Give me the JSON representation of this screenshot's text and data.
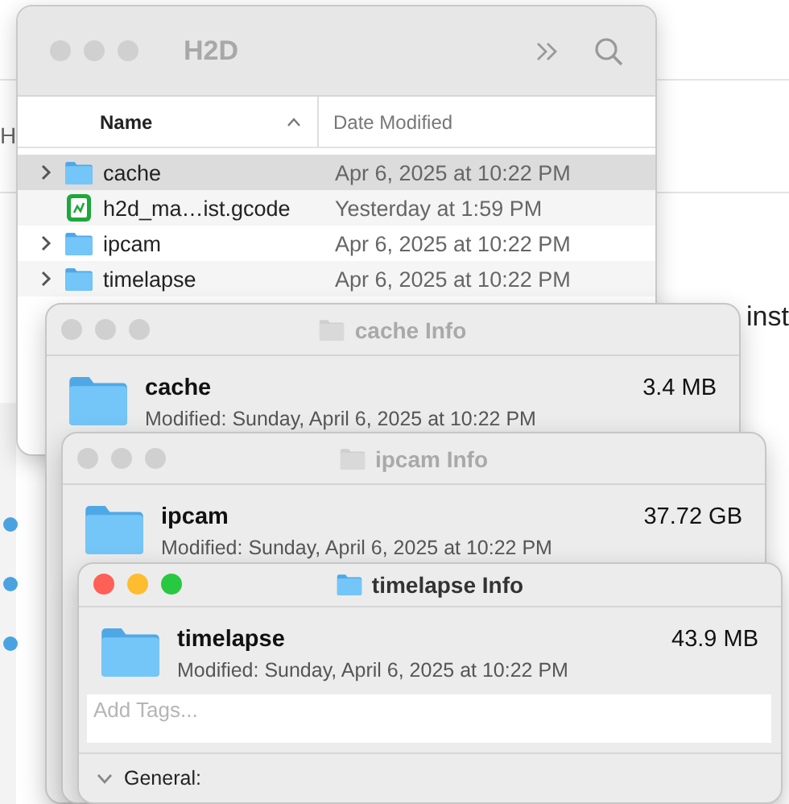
{
  "page": {
    "fragments": [
      {
        "text": "H"
      },
      {
        "text": "inst"
      }
    ]
  },
  "finder": {
    "title": "H2D",
    "columns": [
      {
        "label": "Name",
        "sorted": true
      },
      {
        "label": "Date Modified",
        "sorted": false
      }
    ],
    "rows": [
      {
        "kind": "folder",
        "expandable": true,
        "selected": true,
        "name": "cache",
        "date": "Apr 6, 2025 at 10:22 PM"
      },
      {
        "kind": "gcode",
        "expandable": false,
        "selected": false,
        "name": "h2d_ma…ist.gcode",
        "date": "Yesterday at 1:59 PM"
      },
      {
        "kind": "folder",
        "expandable": true,
        "selected": false,
        "name": "ipcam",
        "date": "Apr 6, 2025 at 10:22 PM"
      },
      {
        "kind": "folder",
        "expandable": true,
        "selected": false,
        "name": "timelapse",
        "date": "Apr 6, 2025 at 10:22 PM"
      }
    ]
  },
  "info_windows": [
    {
      "title": "cache Info",
      "active": false,
      "name": "cache",
      "size": "3.4 MB",
      "modified": "Modified: Sunday, April 6, 2025 at 10:22 PM"
    },
    {
      "title": "ipcam Info",
      "active": false,
      "name": "ipcam",
      "size": "37.72 GB",
      "modified": "Modified: Sunday, April 6, 2025 at 10:22 PM"
    },
    {
      "title": "timelapse Info",
      "active": true,
      "name": "timelapse",
      "size": "43.9 MB",
      "modified": "Modified: Sunday, April 6, 2025 at 10:22 PM",
      "tags": {
        "placeholder": "Add Tags..."
      },
      "sections": [
        {
          "label": "General:",
          "expanded": true
        }
      ]
    }
  ]
}
